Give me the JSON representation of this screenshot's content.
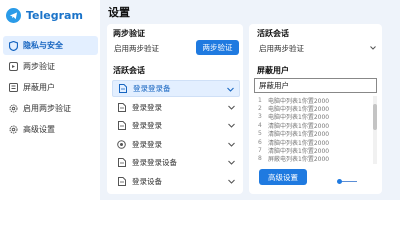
{
  "brand": {
    "name": "Telegram"
  },
  "sidebar": {
    "items": [
      {
        "label": "隐私与安全",
        "icon": "shield-icon",
        "active": true
      },
      {
        "label": "两步验证",
        "icon": "two-step-icon",
        "active": false
      },
      {
        "label": "屏蔽用户",
        "icon": "blocked-icon",
        "active": false
      },
      {
        "label": "启用两步验证",
        "icon": "gear-icon",
        "active": false
      },
      {
        "label": "高级设置",
        "icon": "gear-icon",
        "active": false
      }
    ]
  },
  "main": {
    "title": "设置",
    "two_step": {
      "title": "两步验证",
      "field_value": "启用两步验证",
      "button_label": "两步验证"
    },
    "sessions": {
      "title": "活跃会话",
      "rows": [
        {
          "label": "登录登录备",
          "icon": "document-icon",
          "selected": true
        },
        {
          "label": "登录登录",
          "icon": "document-icon",
          "selected": false
        },
        {
          "label": "登录登录",
          "icon": "document-icon",
          "selected": false
        },
        {
          "label": "登录登录",
          "icon": "settings-dot-icon",
          "selected": false
        },
        {
          "label": "登录登录设备",
          "icon": "document-icon",
          "selected": false
        },
        {
          "label": "登录设备",
          "icon": "document-icon",
          "selected": false
        }
      ]
    },
    "right": {
      "active_title": "活跃会话",
      "active_select": "启用两步验证",
      "blocked_title": "屏蔽用户",
      "blocked_input": "屏蔽用户",
      "users": [
        {
          "num": "1",
          "text": "电脑中列表1你置2000"
        },
        {
          "num": "2",
          "text": "电脑中列表1你置2000"
        },
        {
          "num": "3",
          "text": "电脑中列表1你置2000"
        },
        {
          "num": "4",
          "text": "清脑中列表1你置2000"
        },
        {
          "num": "5",
          "text": "清脑中列表1你置2000"
        },
        {
          "num": "6",
          "text": "清脑中列表1你置2000"
        },
        {
          "num": "7",
          "text": "清脑中列表1你置2000"
        },
        {
          "num": "8",
          "text": "屏蔽电列表1你置2000"
        }
      ],
      "advanced_button": "高级设置"
    }
  },
  "colors": {
    "accent": "#1f7ae0",
    "selected_bg": "#e3efff",
    "main_bg": "#eef3fa"
  }
}
